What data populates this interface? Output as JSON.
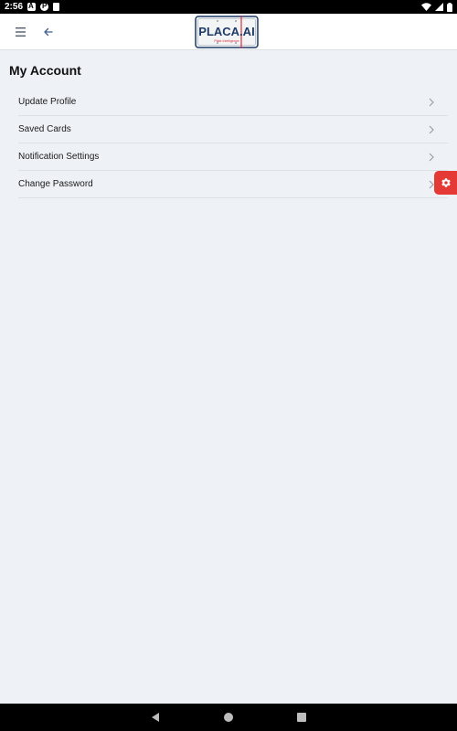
{
  "status_bar": {
    "time": "2:56",
    "notification_icons": [
      "autofill-icon",
      "p-app-icon",
      "sd-card-icon"
    ],
    "system_icons": [
      "wifi-icon",
      "signal-icon",
      "battery-icon"
    ]
  },
  "app_bar": {
    "menu_icon": "hamburger-menu-icon",
    "back_icon": "arrow-left-icon",
    "logo": {
      "text": "PLACA.AI",
      "tagline": "Plate Intelligence",
      "colors": {
        "primary": "#1f3b67",
        "accent": "#d8303c"
      }
    }
  },
  "page": {
    "title": "My Account",
    "menu_items": [
      {
        "label": "Update Profile"
      },
      {
        "label": "Saved Cards"
      },
      {
        "label": "Notification Settings"
      },
      {
        "label": "Change Password"
      }
    ]
  },
  "settings_fab": {
    "icon": "gear-icon",
    "color": "#e53935"
  },
  "nav_bar": {
    "icons": [
      "back-triangle-icon",
      "home-circle-icon",
      "recents-square-icon"
    ]
  },
  "colors": {
    "background": "#eef2f7",
    "app_bar": "#ffffff",
    "divider": "#dde1e6",
    "text": "#1a1a1a"
  }
}
